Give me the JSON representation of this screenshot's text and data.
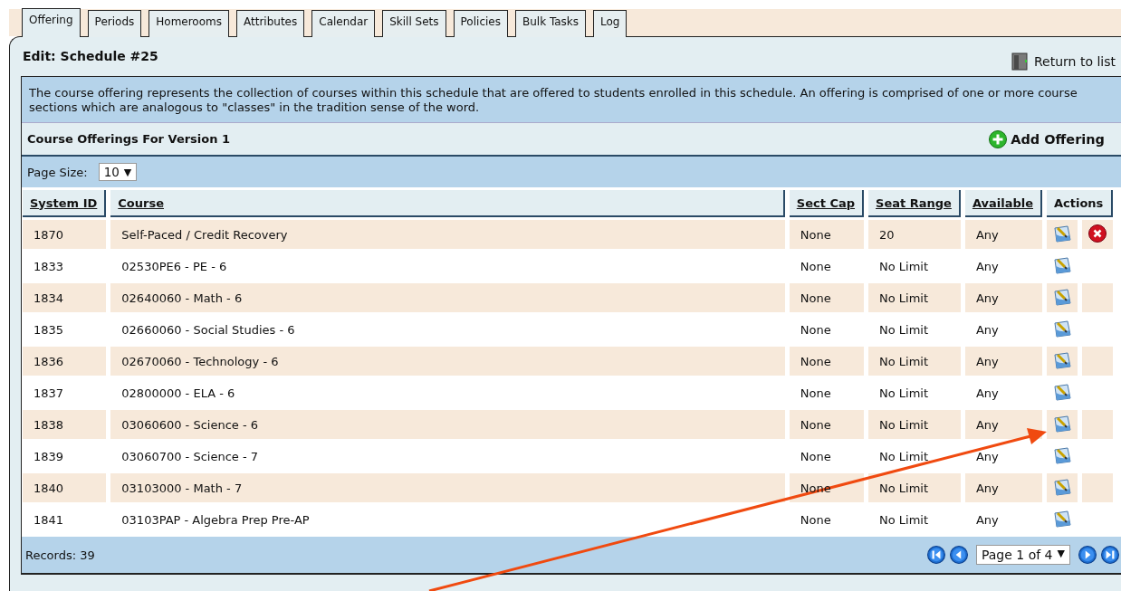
{
  "tabs": [
    {
      "label": "Offering",
      "selected": true
    },
    {
      "label": "Periods",
      "selected": false
    },
    {
      "label": "Homerooms",
      "selected": false
    },
    {
      "label": "Attributes",
      "selected": false
    },
    {
      "label": "Calendar",
      "selected": false
    },
    {
      "label": "Skill Sets",
      "selected": false
    },
    {
      "label": "Policies",
      "selected": false
    },
    {
      "label": "Bulk Tasks",
      "selected": false
    },
    {
      "label": "Log",
      "selected": false
    }
  ],
  "page_title": "Edit: Schedule #25",
  "return_link": "Return to list",
  "description": "The course offering represents the collection of courses within this schedule that are offered to students enrolled in this schedule. An offering is comprised of one or more course sections which are analogous to \"classes\" in the tradition sense of the word.",
  "section_title": "Course Offerings For Version 1",
  "add_button": "Add Offering",
  "page_size": {
    "label": "Page Size:",
    "value": "10",
    "arrow": "▼"
  },
  "table": {
    "columns": [
      "System ID",
      "Course",
      "Sect Cap",
      "Seat Range",
      "Available",
      "Actions"
    ],
    "rows": [
      {
        "id": "1870",
        "course": "Self-Paced / Credit Recovery",
        "sect_cap": "None",
        "seat_range": "20",
        "available": "Any",
        "deletable": true
      },
      {
        "id": "1833",
        "course": "02530PE6 - PE - 6",
        "sect_cap": "None",
        "seat_range": "No Limit",
        "available": "Any",
        "deletable": false
      },
      {
        "id": "1834",
        "course": "02640060 - Math - 6",
        "sect_cap": "None",
        "seat_range": "No Limit",
        "available": "Any",
        "deletable": false
      },
      {
        "id": "1835",
        "course": "02660060 - Social Studies - 6",
        "sect_cap": "None",
        "seat_range": "No Limit",
        "available": "Any",
        "deletable": false
      },
      {
        "id": "1836",
        "course": "02670060 - Technology - 6",
        "sect_cap": "None",
        "seat_range": "No Limit",
        "available": "Any",
        "deletable": false
      },
      {
        "id": "1837",
        "course": "02800000 - ELA - 6",
        "sect_cap": "None",
        "seat_range": "No Limit",
        "available": "Any",
        "deletable": false
      },
      {
        "id": "1838",
        "course": "03060600 - Science - 6",
        "sect_cap": "None",
        "seat_range": "No Limit",
        "available": "Any",
        "deletable": false
      },
      {
        "id": "1839",
        "course": "03060700 - Science - 7",
        "sect_cap": "None",
        "seat_range": "No Limit",
        "available": "Any",
        "deletable": false
      },
      {
        "id": "1840",
        "course": "03103000 - Math - 7",
        "sect_cap": "None",
        "seat_range": "No Limit",
        "available": "Any",
        "deletable": false
      },
      {
        "id": "1841",
        "course": "03103PAP - Algebra Prep Pre-AP",
        "sect_cap": "None",
        "seat_range": "No Limit",
        "available": "Any",
        "deletable": false
      }
    ]
  },
  "footer": {
    "records": "Records: 39",
    "page_select": "Page 1 of 4",
    "arrow": "▼"
  }
}
